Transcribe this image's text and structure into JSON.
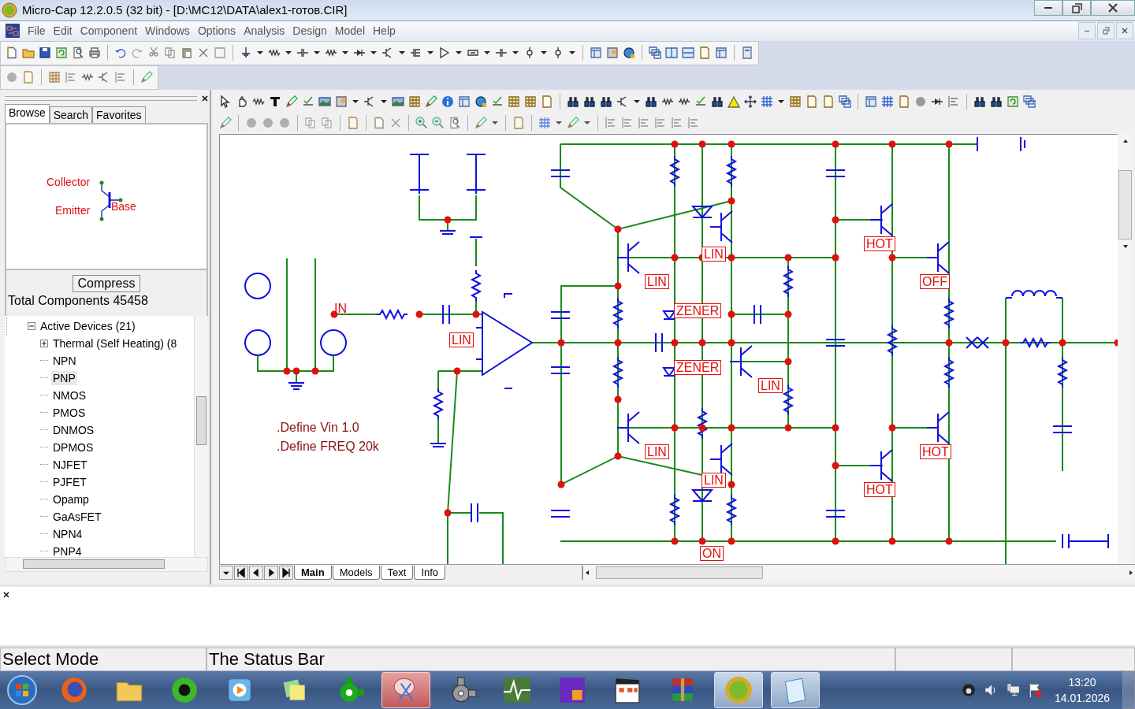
{
  "window": {
    "title": "Micro-Cap 12.2.0.5 (32 bit) - [D:\\MC12\\DATA\\alex1-готов.CIR]"
  },
  "menu": [
    "File",
    "Edit",
    "Component",
    "Windows",
    "Options",
    "Analysis",
    "Design",
    "Model",
    "Help"
  ],
  "browser": {
    "tabs": [
      {
        "label": "Browse",
        "selected": true
      },
      {
        "label": "Search",
        "selected": false
      },
      {
        "label": "Favorites",
        "selected": false
      }
    ],
    "preview": {
      "pins": [
        "Collector",
        "Emitter",
        "Base"
      ]
    },
    "compress_button": "Compress",
    "total": "Total Components 45458",
    "tree": [
      {
        "label": "Active Devices (21)",
        "expanded": true,
        "selected": false,
        "children": [
          {
            "label": "Thermal (Self Heating) (8",
            "expanded": false,
            "selected": false
          },
          {
            "label": "NPN",
            "selected": false
          },
          {
            "label": "PNP",
            "selected": true
          },
          {
            "label": "NMOS",
            "selected": false
          },
          {
            "label": "PMOS",
            "selected": false
          },
          {
            "label": "DNMOS",
            "selected": false
          },
          {
            "label": "DPMOS",
            "selected": false
          },
          {
            "label": "NJFET",
            "selected": false
          },
          {
            "label": "PJFET",
            "selected": false
          },
          {
            "label": "Opamp",
            "selected": false
          },
          {
            "label": "GaAsFET",
            "selected": false
          },
          {
            "label": "NPN4",
            "selected": false
          },
          {
            "label": "PNP4",
            "selected": false
          }
        ]
      }
    ]
  },
  "schematic": {
    "labels": [
      {
        "text": "IN",
        "kind": "plain"
      },
      {
        "text": "LIN",
        "kind": "boxed"
      },
      {
        "text": "LIN",
        "kind": "boxed"
      },
      {
        "text": "LIN",
        "kind": "boxed"
      },
      {
        "text": "ZENER",
        "kind": "boxed"
      },
      {
        "text": "ZENER",
        "kind": "boxed"
      },
      {
        "text": "LIN",
        "kind": "boxed"
      },
      {
        "text": "LIN",
        "kind": "boxed"
      },
      {
        "text": "LIN",
        "kind": "boxed"
      },
      {
        "text": "HOT",
        "kind": "boxed"
      },
      {
        "text": "OFF",
        "kind": "boxed"
      },
      {
        "text": "HOT",
        "kind": "boxed"
      },
      {
        "text": "HOT",
        "kind": "boxed"
      },
      {
        "text": "ON",
        "kind": "boxed"
      },
      {
        "text": ".Define Vin 1.0",
        "kind": "define"
      },
      {
        "text": ".Define FREQ 20k",
        "kind": "define"
      }
    ]
  },
  "sheet_tabs": [
    {
      "label": "Main",
      "selected": true
    },
    {
      "label": "Models",
      "selected": false
    },
    {
      "label": "Text",
      "selected": false
    },
    {
      "label": "Info",
      "selected": false
    }
  ],
  "status_bar": {
    "panes": [
      "Select Mode",
      "The Status Bar"
    ]
  },
  "taskbar": {
    "time": "13:20",
    "date": "14.01.2026"
  }
}
